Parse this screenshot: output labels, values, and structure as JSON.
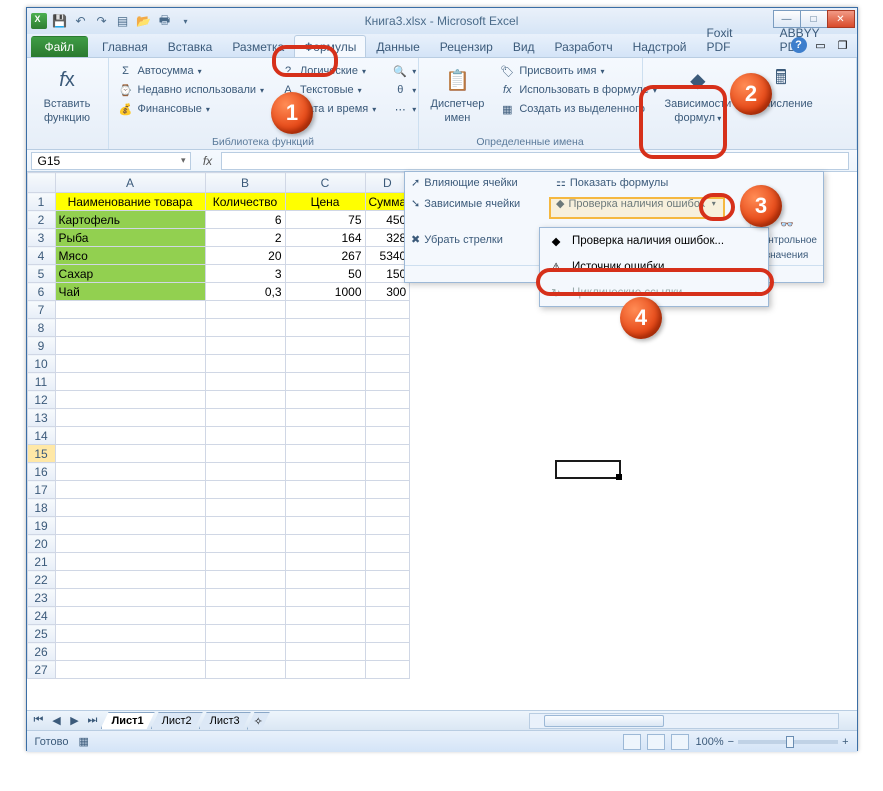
{
  "window": {
    "title": "Книга3.xlsx - Microsoft Excel"
  },
  "qat": {
    "save": "save-icon",
    "undo": "undo-icon",
    "redo": "redo-icon",
    "new": "new-icon",
    "open": "open-icon",
    "qprint": "print-icon"
  },
  "tabs": {
    "file": "Файл",
    "items": [
      "Главная",
      "Вставка",
      "Разметка",
      "Формулы",
      "Данные",
      "Рецензир",
      "Вид",
      "Разработч",
      "Надстрой",
      "Foxit PDF",
      "ABBYY PDF"
    ],
    "active": "Формулы"
  },
  "ribbon": {
    "funclib": {
      "title": "Библиотека функций",
      "insert_fn_top": "Вставить",
      "insert_fn_bot": "функцию",
      "autosum": "Автосумма",
      "recent": "Недавно использовали",
      "financial": "Финансовые",
      "logical": "Логические",
      "text": "Текстовые",
      "datetime": "Дата и время"
    },
    "names": {
      "title": "Определенные имена",
      "manager_top": "Диспетчер",
      "manager_bot": "имен",
      "define": "Присвоить имя",
      "usein": "Использовать в формуле",
      "create": "Создать из выделенного"
    },
    "audit": {
      "title": "Зависимости формул",
      "label_top": "Зависимости",
      "label_bot": "формул",
      "calc": "Вычисление"
    }
  },
  "fa_panel": {
    "trace_prec": "Влияющие ячейки",
    "trace_dep": "Зависимые ячейки",
    "remove_arrows": "Убрать стрелки",
    "show_formulas": "Показать формулы",
    "error_check": "Проверка наличия ошибок",
    "watch_win_top": "Контрольное",
    "watch_win_bot": "значения"
  },
  "fa_menu": {
    "error_check": "Проверка наличия ошибок...",
    "trace_error": "Источник ошибки",
    "circular": "Циклические ссылки"
  },
  "namebox": "G15",
  "columns": [
    "A",
    "B",
    "C",
    "D"
  ],
  "headers": {
    "A": "Наименование товара",
    "B": "Количество",
    "C": "Цена",
    "D": "Сумма"
  },
  "rows": [
    {
      "n": "Картофель",
      "q": "6",
      "p": "75",
      "s": "450"
    },
    {
      "n": "Рыба",
      "q": "2",
      "p": "164",
      "s": "328"
    },
    {
      "n": "Мясо",
      "q": "20",
      "p": "267",
      "s": "5340"
    },
    {
      "n": "Сахар",
      "q": "3",
      "p": "50",
      "s": "150"
    },
    {
      "n": "Чай",
      "q": "0,3",
      "p": "1000",
      "s": "300"
    }
  ],
  "sheets": {
    "active": "Лист1",
    "others": [
      "Лист2",
      "Лист3"
    ]
  },
  "status": {
    "ready": "Готово",
    "zoom": "100%"
  },
  "callouts": {
    "b1": "1",
    "b2": "2",
    "b3": "3",
    "b4": "4"
  }
}
